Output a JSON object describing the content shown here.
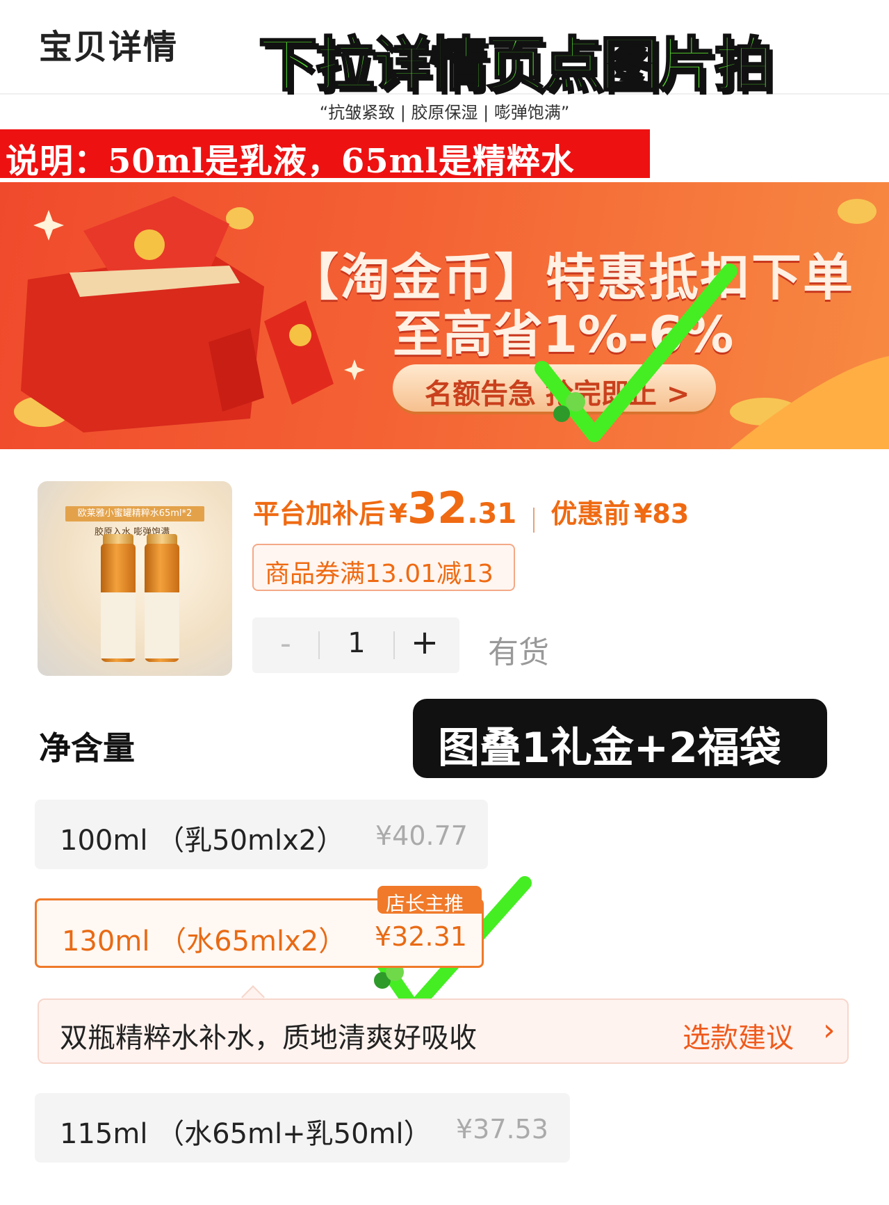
{
  "header": {
    "title": "宝贝详情",
    "overlay_headline": "下拉详情页点图片拍",
    "tagline": "“抗皱紧致 | 胶原保湿 | 嘭弹饱满”"
  },
  "note": {
    "text": "说明：50ml是乳液，65ml是精粹水"
  },
  "banner": {
    "line1": "【淘金币】特惠抵扣下单",
    "line2": "至高省1%-6%",
    "cta": "名额告急 抢完即止 >"
  },
  "product": {
    "thumbnail_caption": "欧莱雅小蜜罐精粹水65ml*2",
    "thumbnail_sub": "胶原入水  嘭弹饱满",
    "price_label": "平台加补后",
    "currency": "¥",
    "price_int": "32",
    "price_dec": ".31",
    "orig_label": "优惠前",
    "orig_price": "¥83",
    "coupon": "商品券满13.01减13",
    "quantity": "1",
    "minus": "-",
    "plus": "+",
    "stock": "有货"
  },
  "spec": {
    "title": "净含量",
    "overlay_badge": "图叠1礼金+2福袋",
    "options": [
      {
        "label": "100ml （乳50mlx2）",
        "price": "¥40.77"
      },
      {
        "label": "130ml （水65mlx2）",
        "price": "¥32.31",
        "badge": "店长主推"
      },
      {
        "label": "115ml （水65ml+乳50ml）",
        "price": "¥37.53"
      }
    ],
    "suggestion": {
      "text": "双瓶精粹水补水，质地清爽好吸收",
      "link": "选款建议",
      "chevron": "›"
    }
  },
  "colors": {
    "accent_orange": "#ef6a12",
    "headline_green": "#55e02c",
    "note_red": "#ee1111",
    "check_green": "#44ee22"
  },
  "icons": [
    "check-mark-icon",
    "chevron-right-icon",
    "minus-icon",
    "plus-icon"
  ]
}
